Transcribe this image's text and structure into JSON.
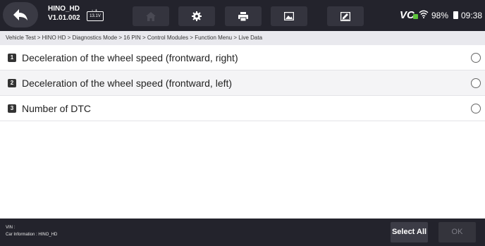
{
  "header": {
    "app_name": "HINO_HD",
    "version": "V1.01.002",
    "battery_voltage": "13.1V",
    "vci_label": "VC",
    "battery_percent": "98%",
    "time": "09:38",
    "icons": [
      "back-arrow-icon",
      "home-icon",
      "gear-icon",
      "printer-icon",
      "image-icon",
      "edit-icon",
      "wifi-icon",
      "battery-icon"
    ]
  },
  "breadcrumb": "Vehicle Test > HINO HD > Diagnostics Mode > 16 PIN > Control Modules > Function Menu > Live Data",
  "items": [
    {
      "num": "1",
      "label": "Deceleration of the wheel speed (frontward, right)"
    },
    {
      "num": "2",
      "label": "Deceleration of the wheel speed (frontward, left)"
    },
    {
      "num": "3",
      "label": "Number of DTC"
    }
  ],
  "footer": {
    "vin_label": "VIN :",
    "car_info": "Car Information : HINO_HD",
    "select_all": "Select All",
    "ok": "OK"
  },
  "colors": {
    "bar": "#23232c",
    "accent_green": "#5ec43c"
  }
}
